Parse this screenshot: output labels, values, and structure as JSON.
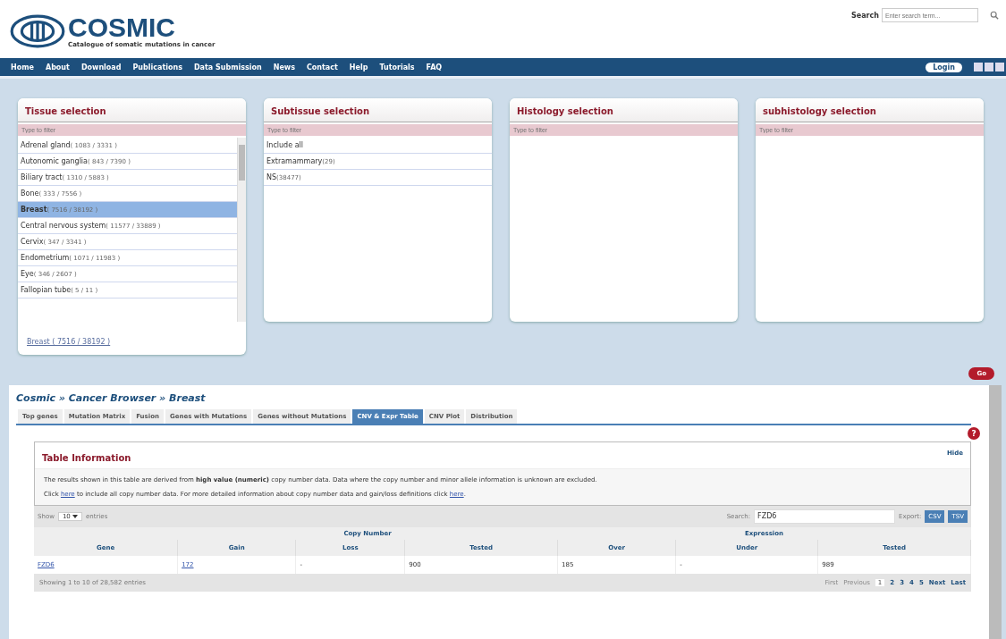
{
  "header": {
    "logo": "COSMIC",
    "tagline": "Catalogue of somatic mutations in cancer",
    "search_label": "Search",
    "search_placeholder": "Enter search term..."
  },
  "nav": {
    "items": [
      "Home",
      "About",
      "Download",
      "Publications",
      "Data Submission",
      "News",
      "Contact",
      "Help",
      "Tutorials",
      "FAQ"
    ],
    "login": "Login"
  },
  "selectors": [
    {
      "title": "Tissue selection",
      "placeholder": "Type to filter",
      "items": [
        {
          "name": "Adrenal gland",
          "count": "( 1083 / 3331 )",
          "selected": false
        },
        {
          "name": "Autonomic ganglia",
          "count": "( 843 / 7390 )",
          "selected": false
        },
        {
          "name": "Biliary tract",
          "count": "( 1310 / 5883 )",
          "selected": false
        },
        {
          "name": "Bone",
          "count": "( 333 / 7556 )",
          "selected": false
        },
        {
          "name": "Breast",
          "count": "( 7516 / 38192 )",
          "selected": true
        },
        {
          "name": "Central nervous system",
          "count": "( 11577 / 33889 )",
          "selected": false
        },
        {
          "name": "Cervix",
          "count": "( 347 / 3341 )",
          "selected": false
        },
        {
          "name": "Endometrium",
          "count": "( 1071 / 11983 )",
          "selected": false
        },
        {
          "name": "Eye",
          "count": "( 346 / 2607 )",
          "selected": false
        },
        {
          "name": "Fallopian tube",
          "count": "( 5 / 11 )",
          "selected": false
        }
      ],
      "current": "Breast ( 7516 / 38192 )"
    },
    {
      "title": "Subtissue selection",
      "placeholder": "Type to filter",
      "items": [
        {
          "name": "Include all",
          "selected": false
        },
        {
          "name": "Extramammary",
          "count": "(29)",
          "selected": false
        },
        {
          "name": "NS",
          "count": "(38477)",
          "selected": false
        }
      ]
    },
    {
      "title": "Histology selection",
      "placeholder": "Type to filter"
    },
    {
      "title": "subhistology selection",
      "placeholder": "Type to filter"
    }
  ],
  "go_button": "Go",
  "browser": {
    "breadcrumb": "Cosmic » Cancer Browser » Breast",
    "tabs": [
      {
        "label": "Top genes",
        "selected": false
      },
      {
        "label": "Mutation Matrix",
        "selected": false
      },
      {
        "label": "Fusion",
        "selected": false
      },
      {
        "label": "Genes with Mutations",
        "selected": false
      },
      {
        "label": "Genes without Mutations",
        "selected": false
      },
      {
        "label": "CNV & Expr Table",
        "selected": true
      },
      {
        "label": "CNV Plot",
        "selected": false
      },
      {
        "label": "Distribution",
        "selected": false
      }
    ],
    "help": "?",
    "info": {
      "title": "Table Information",
      "hide": "Hide",
      "paragraph_1": "The results shown in this table are derived from **high value (numeric)** copy number data. Data where the copy number and minor allele information is unknown are excluded.",
      "paragraph_2": [
        {
          "kind": "text",
          "text": "Click "
        },
        {
          "kind": "link",
          "text": "here"
        },
        {
          "kind": "text",
          "text": " to include all copy number data. For more detailed information about copy number data and gain/loss definitions click "
        },
        {
          "kind": "link",
          "text": "here"
        },
        {
          "kind": "text",
          "text": "."
        }
      ]
    },
    "show_label": "Show",
    "page_size": "10",
    "entries_label": "entries",
    "search_label": "Search:",
    "search_value": "FZD6",
    "export_label": "Export:",
    "export_buttons": [
      "CSV",
      "TSV"
    ],
    "table": {
      "groups": [
        "Copy Number",
        "Expression"
      ],
      "columns": [
        "Gene",
        "Gain",
        "Loss",
        "Tested",
        "Over",
        "Under",
        "Tested"
      ],
      "rows": [
        {
          "cells": [
            {
              "text": "FZD6",
              "link": true
            },
            {
              "text": "172",
              "link": true
            },
            {
              "text": "-",
              "link": false
            },
            {
              "text": "900",
              "link": false
            },
            {
              "text": "185",
              "link": false
            },
            {
              "text": "-",
              "link": false
            },
            {
              "text": "989",
              "link": false
            }
          ]
        }
      ]
    },
    "footer_info": "Showing 1 to 10 of 28,582 entries",
    "pagination": [
      {
        "label": "First",
        "disabled": true,
        "selected": false
      },
      {
        "label": "Previous",
        "disabled": true,
        "selected": false
      },
      {
        "label": "1",
        "disabled": false,
        "selected": true
      },
      {
        "label": "2",
        "disabled": false,
        "selected": false
      },
      {
        "label": "3",
        "disabled": false,
        "selected": false
      },
      {
        "label": "4",
        "disabled": false,
        "selected": false
      },
      {
        "label": "5",
        "disabled": false,
        "selected": false
      },
      {
        "label": "Next",
        "disabled": false,
        "selected": false
      },
      {
        "label": "Last",
        "disabled": false,
        "selected": false
      }
    ]
  }
}
